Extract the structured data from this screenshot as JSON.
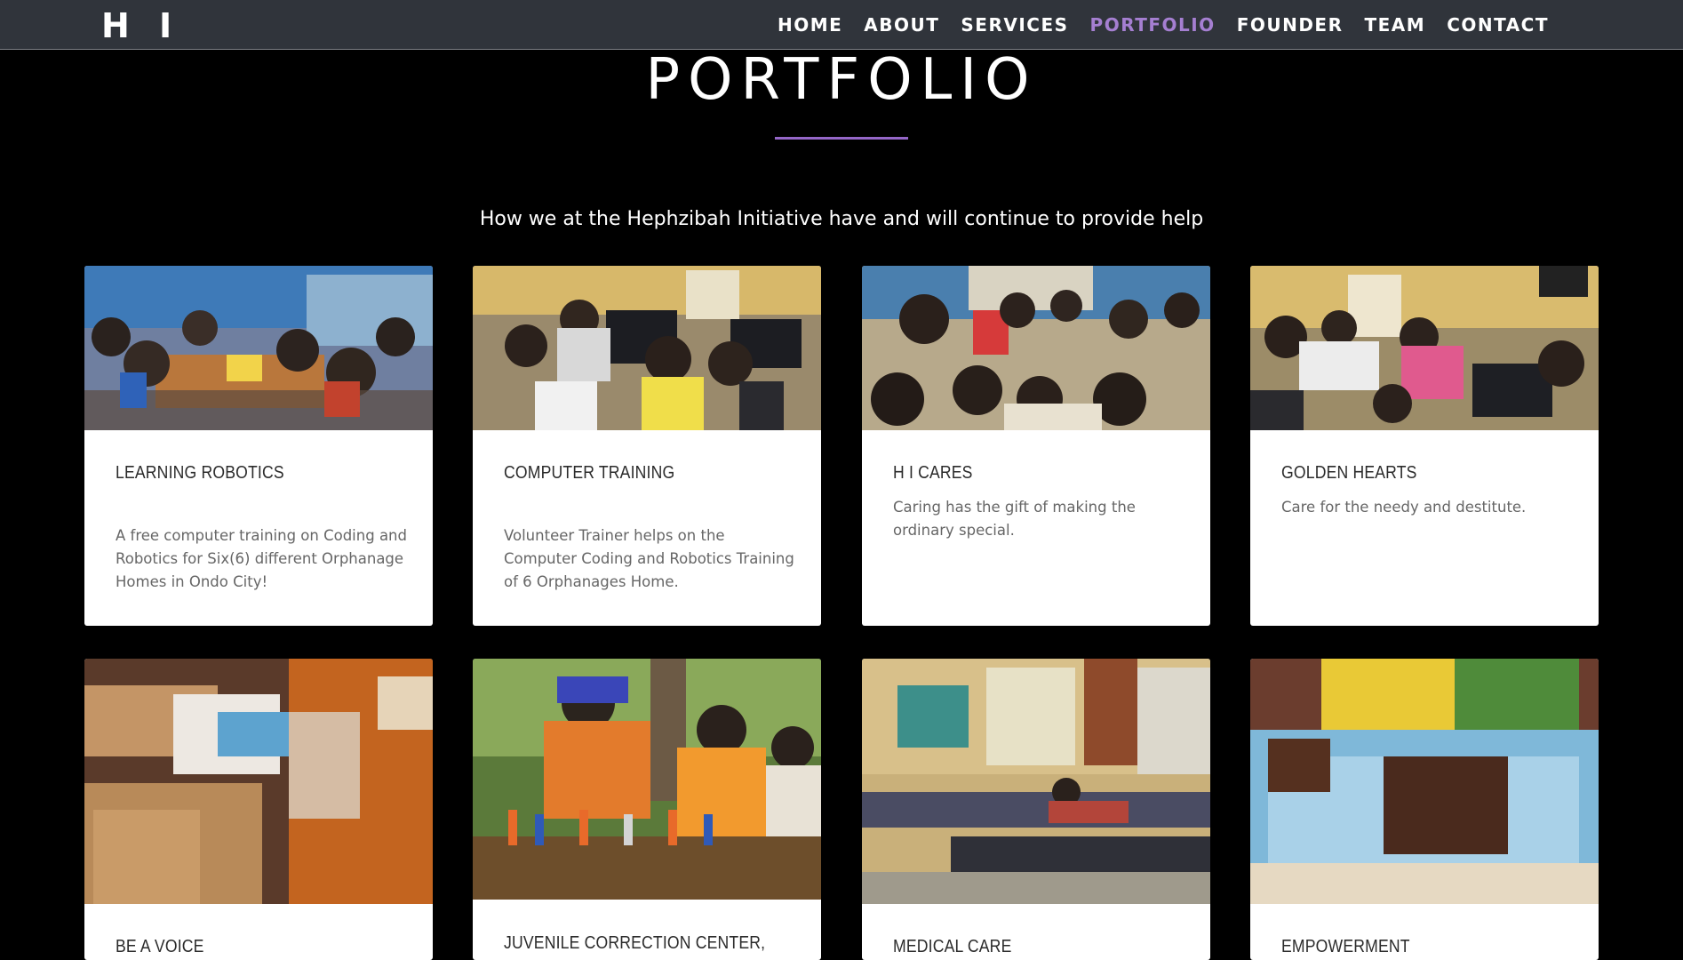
{
  "header": {
    "logo": "H I",
    "nav": [
      {
        "label": "HOME",
        "active": false
      },
      {
        "label": "ABOUT",
        "active": false
      },
      {
        "label": "SERVICES",
        "active": false
      },
      {
        "label": "PORTFOLIO",
        "active": true
      },
      {
        "label": "FOUNDER",
        "active": false
      },
      {
        "label": "TEAM",
        "active": false
      },
      {
        "label": "CONTACT",
        "active": false
      }
    ]
  },
  "main": {
    "title": "PORTFOLIO",
    "subtitle": "How we at the Hephzibah Initiative have and will continue to provide help",
    "cards": [
      {
        "title": "LEARNING ROBOTICS",
        "description": "A free computer training on Coding and Robotics for Six(6) different Orphanage Homes in Ondo City!"
      },
      {
        "title": "COMPUTER TRAINING",
        "description": "Volunteer Trainer helps on the Computer Coding and Robotics Training of 6 Orphanages Home."
      },
      {
        "title": "H I CARES",
        "description": "Caring has the gift of making the ordinary special."
      },
      {
        "title": "GOLDEN HEARTS",
        "description": "Care for the needy and destitute."
      },
      {
        "title": "BE A VOICE",
        "description": ""
      },
      {
        "title": "JUVENILE CORRECTION CENTER,",
        "description": ""
      },
      {
        "title": "MEDICAL CARE",
        "description": ""
      },
      {
        "title": "EMPOWERMENT",
        "description": ""
      }
    ]
  },
  "colors": {
    "page_background": "#000000",
    "navbar_background": "#30343b",
    "accent": "#a57fd1",
    "underline": "#9466c7",
    "card_background": "#ffffff"
  },
  "icons": [
    "photo-placeholder"
  ]
}
